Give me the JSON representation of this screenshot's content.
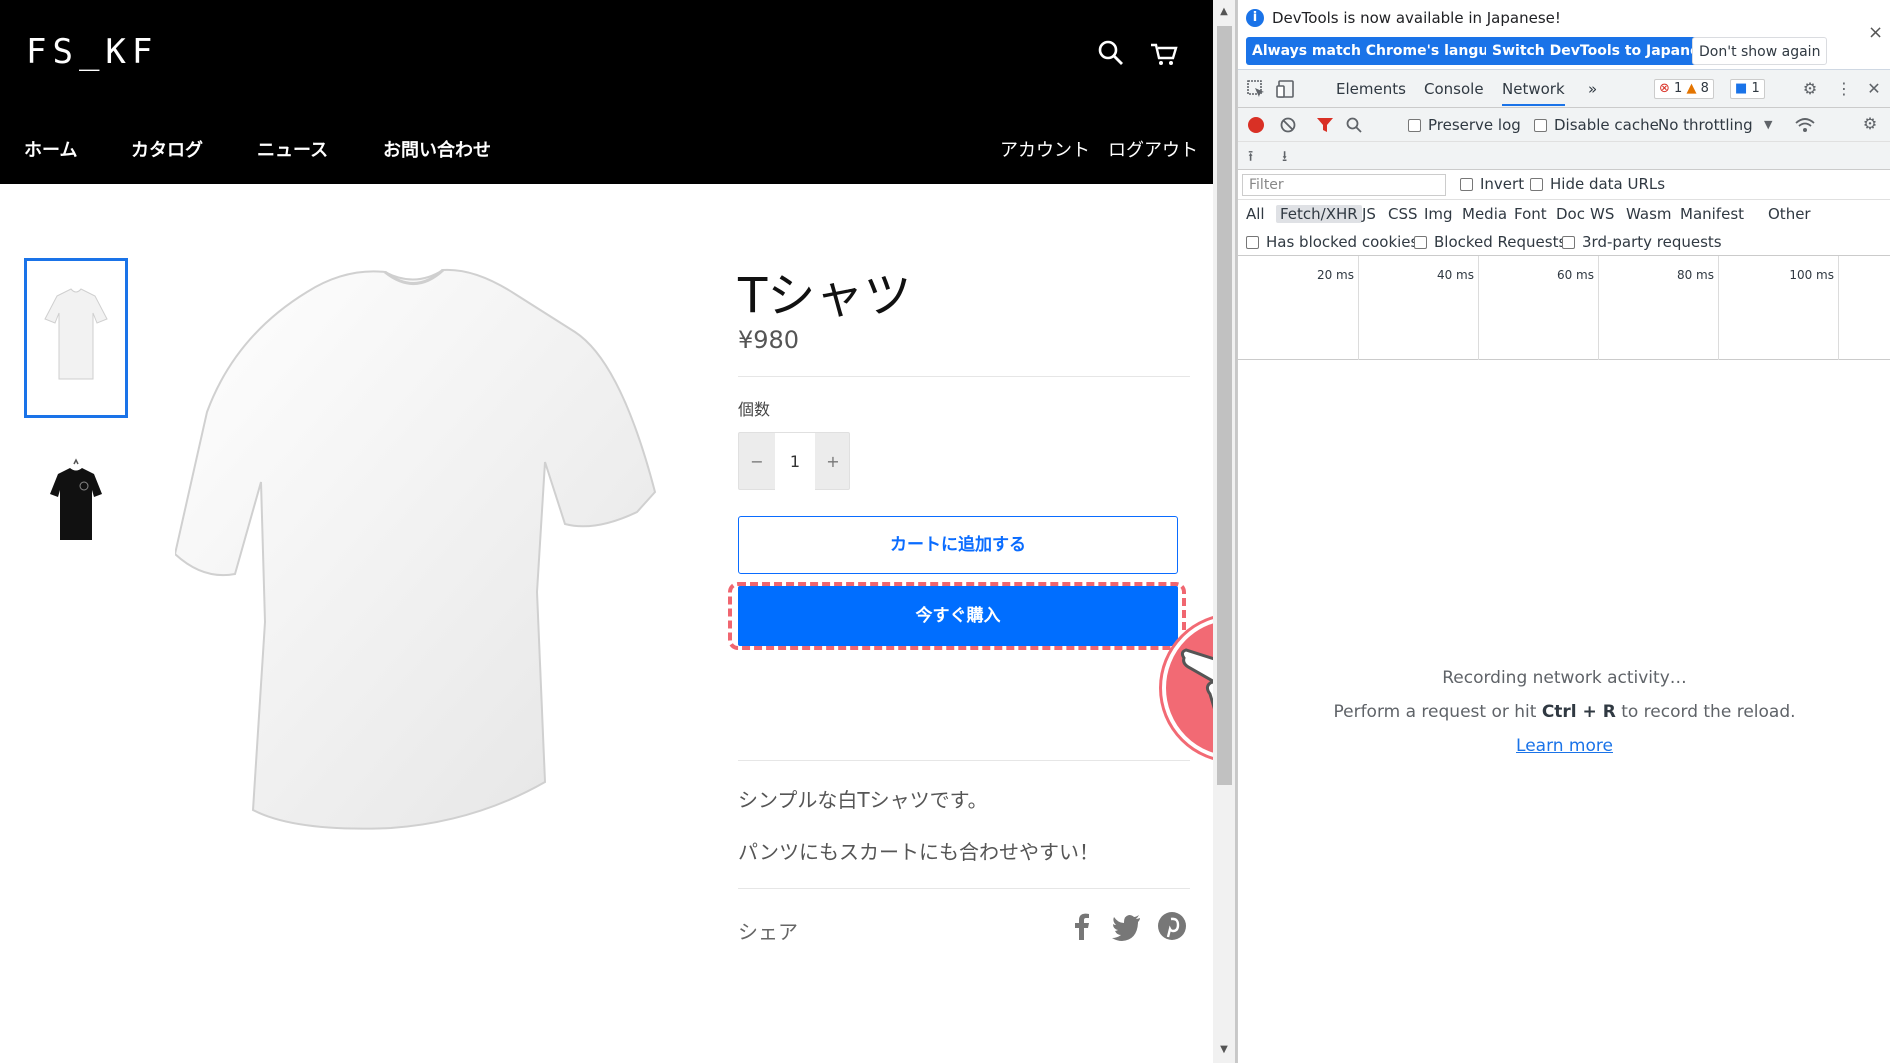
{
  "store": {
    "logo": "FS_KF",
    "nav": [
      "ホーム",
      "カタログ",
      "ニュース",
      "お問い合わせ"
    ],
    "nav_right": [
      "アカウント",
      "ログアウト"
    ],
    "product": {
      "title": "Tシャツ",
      "price": "¥980",
      "qty_label": "個数",
      "qty_minus": "−",
      "qty_value": "1",
      "qty_plus": "+",
      "add_to_cart": "カートに追加する",
      "buy_now": "今すぐ購入",
      "description_1": "シンプルな白Tシャツです。",
      "description_2": "パンツにもスカートにも合わせやすい！",
      "share_label": "シェア"
    }
  },
  "devtools": {
    "info_text": "DevTools is now available in Japanese!",
    "btn_match": "Always match Chrome's language",
    "btn_switch": "Switch DevTools to Japanese",
    "btn_dont": "Don't show again",
    "info_close": "×",
    "tabs": [
      "Elements",
      "Console",
      "Network"
    ],
    "more_tabs": "»",
    "error_count": "1",
    "warning_count": "8",
    "message_count": "1",
    "preserve_log": "Preserve log",
    "disable_cache": "Disable cache",
    "throttling": "No throttling",
    "filter_placeholder": "Filter",
    "invert": "Invert",
    "hide_data_urls": "Hide data URLs",
    "types": [
      "All",
      "Fetch/XHR",
      "JS",
      "CSS",
      "Img",
      "Media",
      "Font",
      "Doc",
      "WS",
      "Wasm",
      "Manifest",
      "Other"
    ],
    "has_blocked_cookies": "Has blocked cookies",
    "blocked_requests": "Blocked Requests",
    "third_party": "3rd-party requests",
    "ticks": [
      "20 ms",
      "40 ms",
      "60 ms",
      "80 ms",
      "100 ms"
    ],
    "recording": "Recording network activity…",
    "perform_pre": "Perform a request or hit ",
    "perform_key": "Ctrl + R",
    "perform_post": " to record the reload.",
    "learn_more": "Learn more"
  },
  "colors": {
    "accent": "#006eff",
    "highlight": "#f06670",
    "devtools_blue": "#1a73e8"
  }
}
